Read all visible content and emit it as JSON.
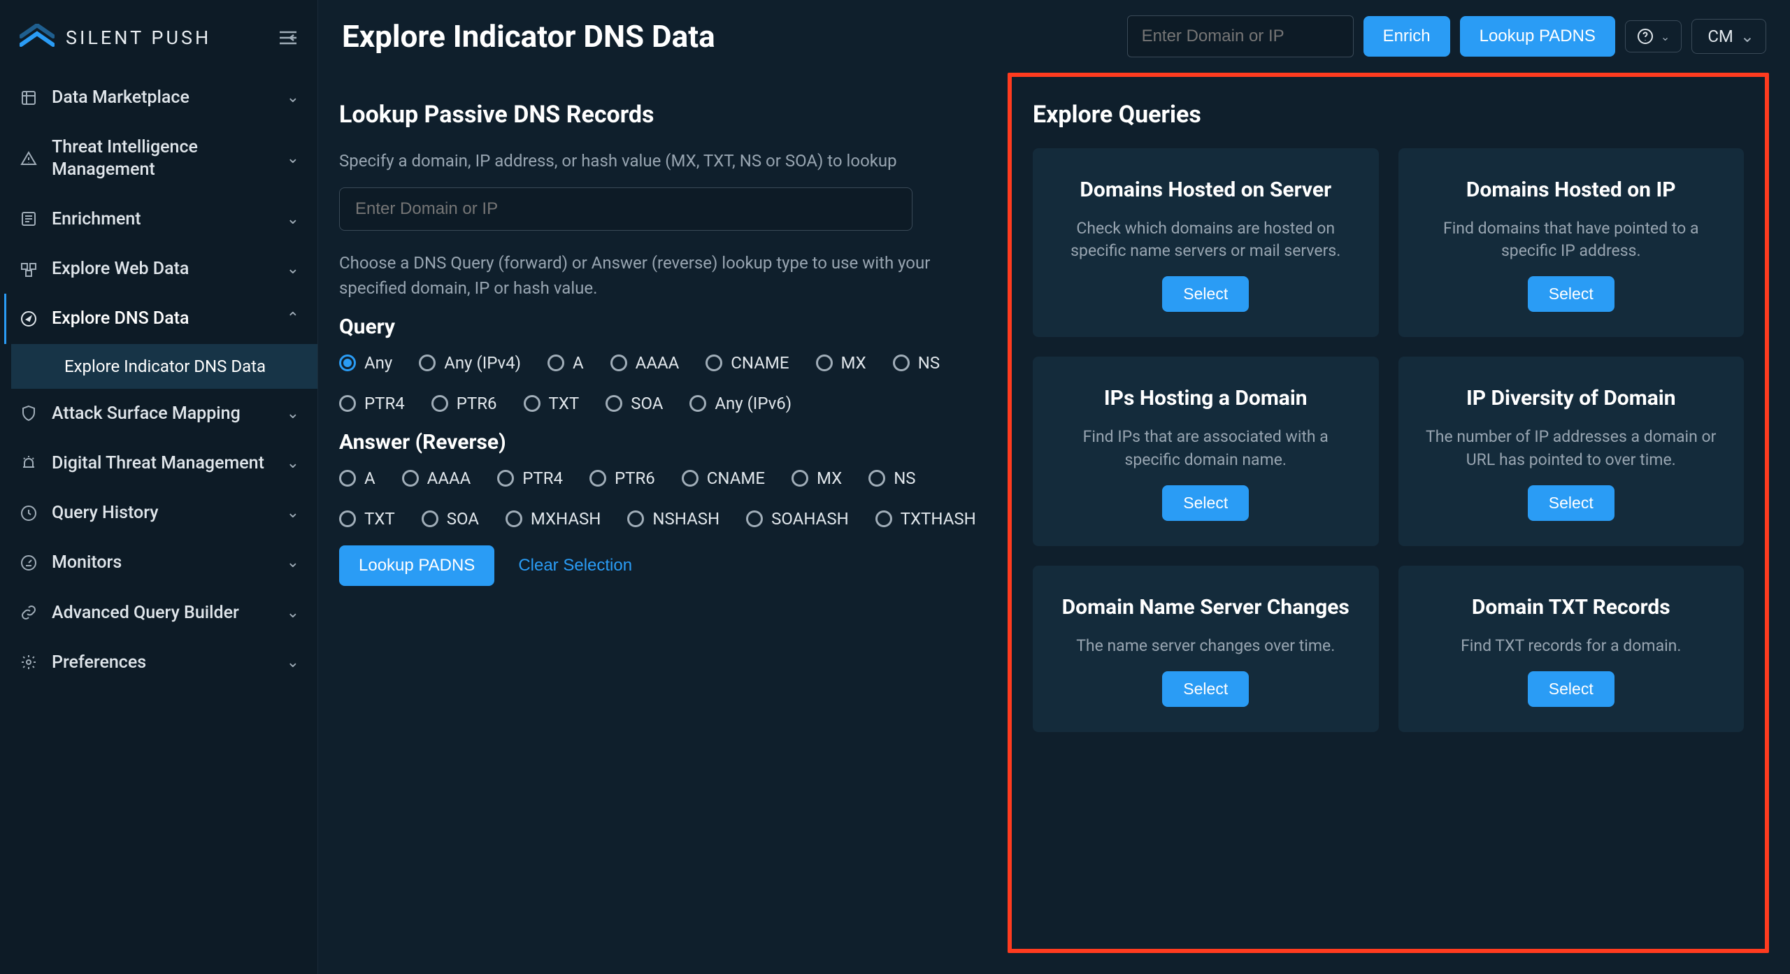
{
  "brand": "SILENT PUSH",
  "header": {
    "title": "Explore Indicator DNS Data",
    "search_placeholder": "Enter Domain or IP",
    "enrich_label": "Enrich",
    "lookup_label": "Lookup PADNS",
    "user_initials": "CM"
  },
  "sidebar": {
    "items": [
      {
        "label": "Data Marketplace",
        "icon": "grid-icon"
      },
      {
        "label": "Threat Intelligence Management",
        "icon": "warning-icon"
      },
      {
        "label": "Enrichment",
        "icon": "list-icon"
      },
      {
        "label": "Explore Web Data",
        "icon": "web-icon"
      },
      {
        "label": "Explore DNS Data",
        "icon": "compass-icon",
        "expanded": true
      },
      {
        "label": "Attack Surface Mapping",
        "icon": "shield-icon"
      },
      {
        "label": "Digital Threat Management",
        "icon": "siren-icon"
      },
      {
        "label": "Query History",
        "icon": "clock-icon"
      },
      {
        "label": "Monitors",
        "icon": "gauge-icon"
      },
      {
        "label": "Advanced Query Builder",
        "icon": "link-icon"
      },
      {
        "label": "Preferences",
        "icon": "gear-icon"
      }
    ],
    "sub_item": "Explore Indicator DNS Data"
  },
  "lookup": {
    "section_title": "Lookup Passive DNS Records",
    "spec_desc": "Specify a domain, IP address, or hash value (MX, TXT, NS or SOA) to lookup",
    "input_placeholder": "Enter Domain or IP",
    "choose_desc": "Choose a DNS Query (forward) or Answer (reverse) lookup type to use with your specified domain, IP or hash value.",
    "query_heading": "Query",
    "query_options": [
      "Any",
      "Any (IPv4)",
      "A",
      "AAAA",
      "CNAME",
      "MX",
      "NS",
      "PTR4",
      "PTR6",
      "TXT",
      "SOA",
      "Any (IPv6)"
    ],
    "query_selected": "Any",
    "answer_heading": "Answer (Reverse)",
    "answer_options": [
      "A",
      "AAAA",
      "PTR4",
      "PTR6",
      "CNAME",
      "MX",
      "NS",
      "TXT",
      "SOA",
      "MXHASH",
      "NSHASH",
      "SOAHASH",
      "TXTHASH"
    ],
    "lookup_btn": "Lookup PADNS",
    "clear_btn": "Clear Selection"
  },
  "explore": {
    "title": "Explore Queries",
    "cards": [
      {
        "title": "Domains Hosted on Server",
        "desc": "Check which domains are hosted on specific name servers or mail servers.",
        "btn": "Select"
      },
      {
        "title": "Domains Hosted on IP",
        "desc": "Find domains that have pointed to a specific IP address.",
        "btn": "Select"
      },
      {
        "title": "IPs Hosting a Domain",
        "desc": "Find IPs that are associated with a specific domain name.",
        "btn": "Select"
      },
      {
        "title": "IP Diversity of Domain",
        "desc": "The number of IP addresses a domain or URL has pointed to over time.",
        "btn": "Select"
      },
      {
        "title": "Domain Name Server Changes",
        "desc": "The name server changes over time.",
        "btn": "Select"
      },
      {
        "title": "Domain TXT Records",
        "desc": "Find TXT records for a domain.",
        "btn": "Select"
      }
    ]
  }
}
